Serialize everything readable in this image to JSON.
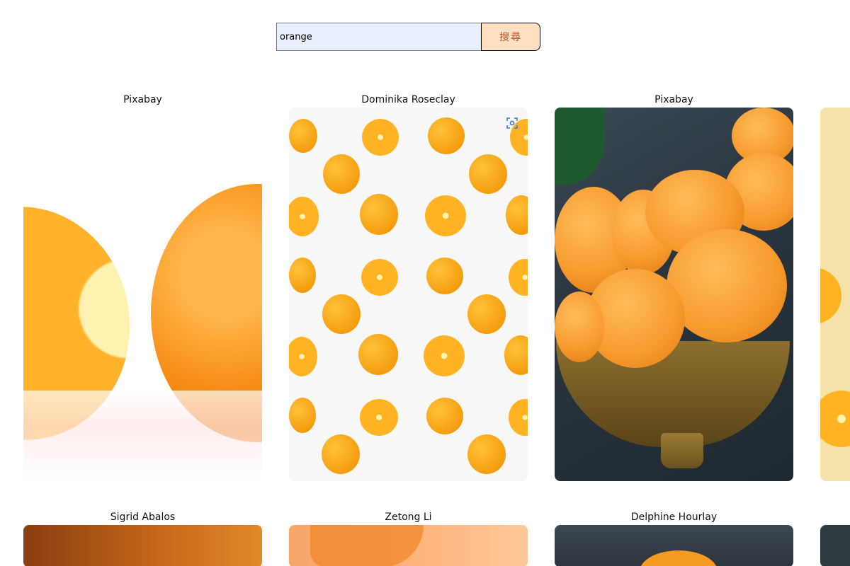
{
  "search": {
    "value": "orange",
    "button_label": "搜尋"
  },
  "cards": [
    {
      "author": "Pixabay"
    },
    {
      "author": "Dominika Roseclay"
    },
    {
      "author": "Pixabay"
    },
    {
      "author": "Sigrid Abalos"
    },
    {
      "author": "Zetong Li"
    },
    {
      "author": "Delphine Hourlay"
    }
  ],
  "colors": {
    "search_input_bg": "#e8f0fe",
    "search_button_bg": "#ffdfc0",
    "search_button_text": "#b2532c"
  },
  "icons": {
    "visual_search": "scan-icon"
  }
}
